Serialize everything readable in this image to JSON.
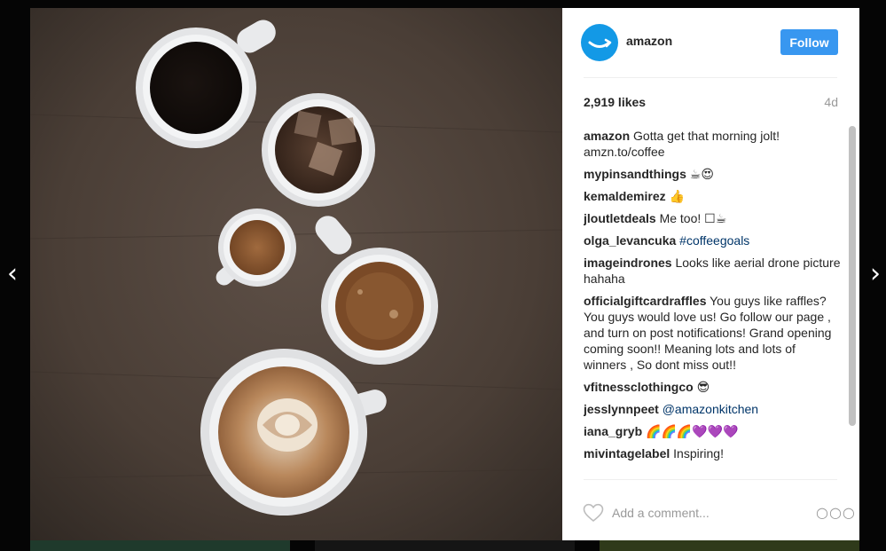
{
  "post": {
    "username": "amazon",
    "follow_label": "Follow",
    "likes": "2,919 likes",
    "time": "4d"
  },
  "caption": {
    "user": "amazon",
    "text": "Gotta get that morning jolt! amzn.to/coffee"
  },
  "comments": [
    {
      "user": "mypinsandthings",
      "text": "☕😍"
    },
    {
      "user": "kemaldemirez",
      "text": "👍"
    },
    {
      "user": "jloutletdeals",
      "text": "Me too! ☐☕"
    },
    {
      "user": "olga_levancuka",
      "text": "",
      "link": "#coffeegoals"
    },
    {
      "user": "imageindrones",
      "text": "Looks like aerial drone picture hahaha"
    },
    {
      "user": "officialgiftcardraffles",
      "text": "You guys like raffles? You guys would love us! Go follow our page , and turn on post notifications! Grand opening coming soon!! Meaning lots and lots of winners , So dont miss out!!"
    },
    {
      "user": "vfitnessclothingco",
      "text": "😎"
    },
    {
      "user": "jesslynnpeet",
      "text": "",
      "link": "@amazonkitchen"
    },
    {
      "user": "iana_gryb",
      "text": "🌈🌈🌈💜💜💜"
    },
    {
      "user": "mivintagelabel",
      "text": "Inspiring!"
    }
  ],
  "add_comment": {
    "placeholder": "Add a comment...",
    "more_label": "○○○"
  },
  "nav": {
    "prev": "‹",
    "next": "›"
  },
  "icons": {
    "avatar": "amazon-smile-logo",
    "heart": "heart-outline-icon",
    "more": "more-options-icon"
  },
  "colors": {
    "follow_button": "#3897f0",
    "avatar_bg": "#1399e6",
    "link": "#003569"
  }
}
